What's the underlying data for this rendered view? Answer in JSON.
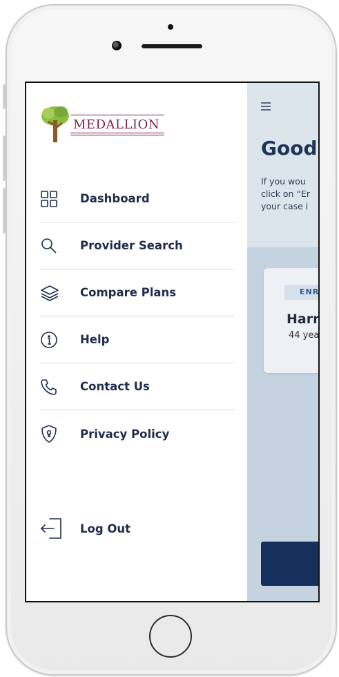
{
  "brand": {
    "logo_text": "MEDALLION"
  },
  "drawer": {
    "items": [
      {
        "label": "Dashboard",
        "icon": "grid-icon"
      },
      {
        "label": "Provider Search",
        "icon": "search-icon"
      },
      {
        "label": "Compare Plans",
        "icon": "layers-icon"
      },
      {
        "label": "Help",
        "icon": "info-icon"
      },
      {
        "label": "Contact Us",
        "icon": "phone-icon"
      },
      {
        "label": "Privacy Policy",
        "icon": "shield-icon"
      }
    ],
    "logout": {
      "label": "Log Out",
      "icon": "logout-icon"
    }
  },
  "background": {
    "greeting": "Good",
    "intro_lines": [
      "If you wou",
      "click on “Er",
      "your case i"
    ],
    "card": {
      "badge": "ENR",
      "name": "Harr",
      "age": "44 yea"
    }
  },
  "colors": {
    "navy_text": "#1f2d4a",
    "brand_maroon": "#7a1f3a",
    "cta_navy": "#15305a",
    "overlay_blue": "#c5d3e1"
  }
}
